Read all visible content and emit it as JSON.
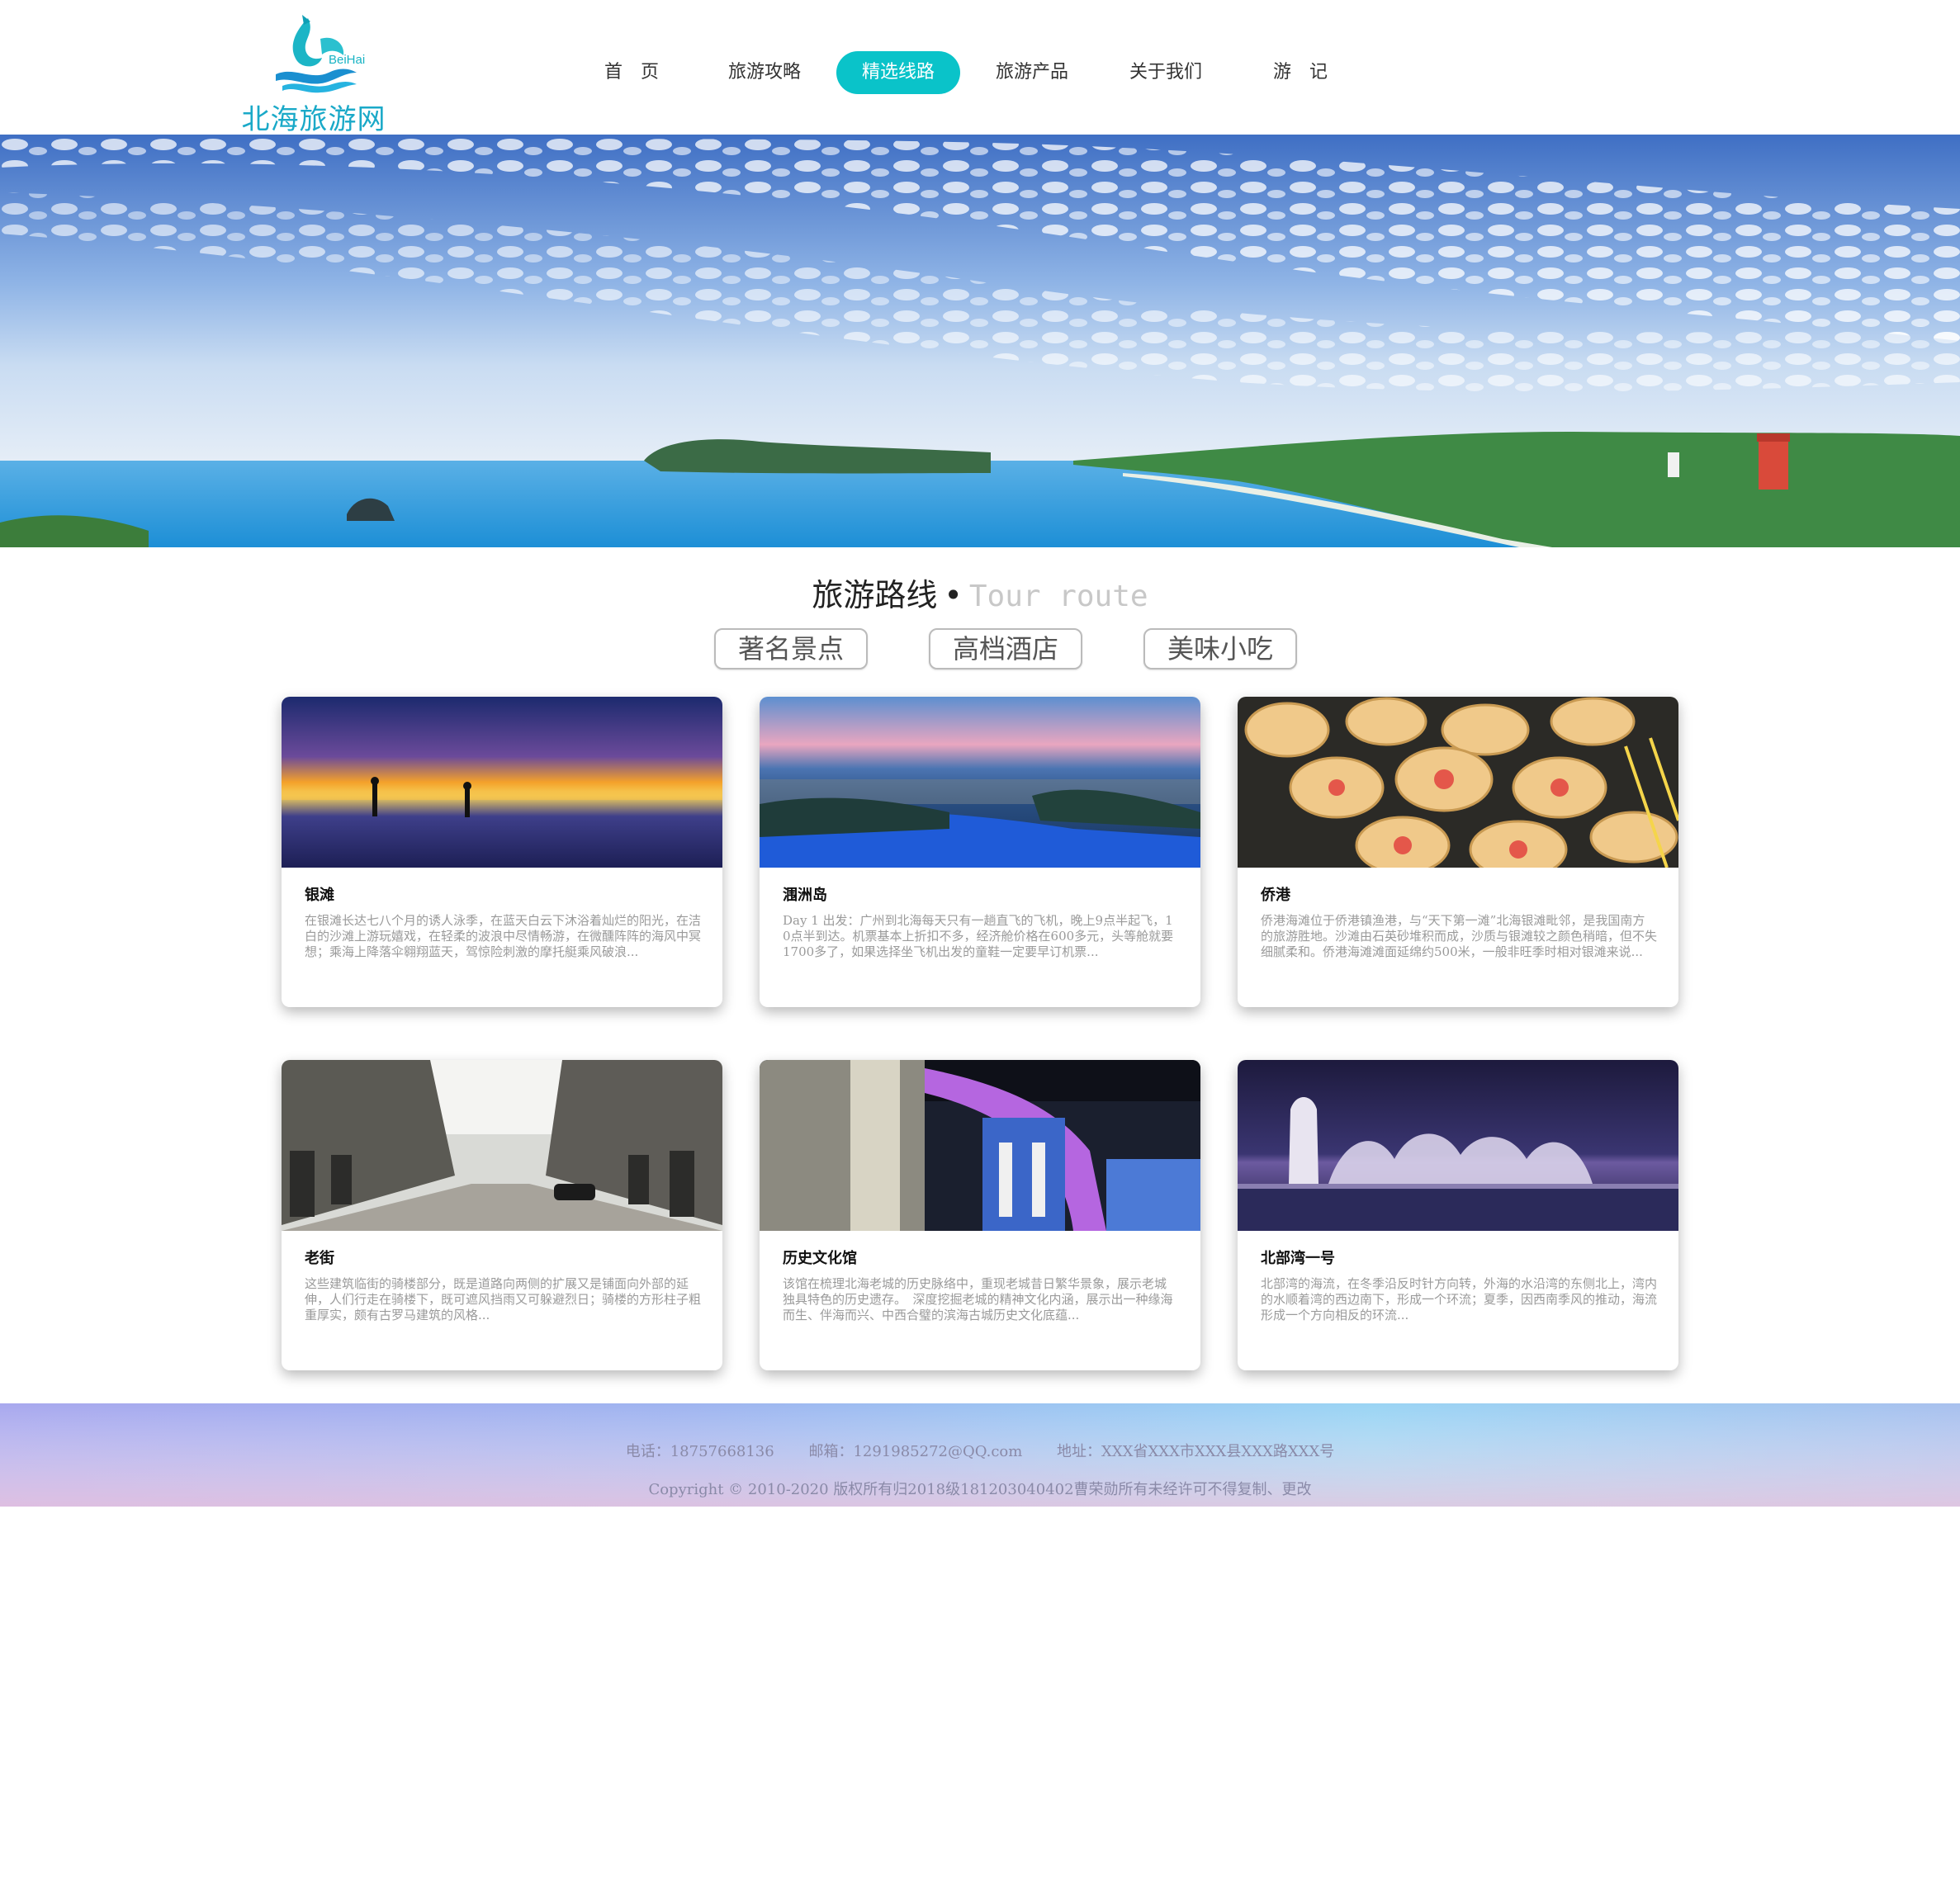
{
  "logo": {
    "title": "北海旅游网",
    "sub": "BeiHai"
  },
  "nav": {
    "items": [
      "首　页",
      "旅游攻略",
      "精选线路",
      "旅游产品",
      "关于我们",
      "游　记"
    ],
    "active_index": 2
  },
  "section": {
    "title": "旅游路线",
    "dot": "•",
    "title_en": "Tour route"
  },
  "tabs": [
    "著名景点",
    "高档酒店",
    "美味小吃"
  ],
  "cards": [
    {
      "title": "银滩",
      "desc": "在银滩长达七八个月的诱人泳季，在蓝天白云下沐浴着灿烂的阳光，在洁白的沙滩上游玩嬉戏，在轻柔的波浪中尽情畅游，在微醺阵阵的海风中冥想；乘海上降落伞翱翔蓝天，驾惊险刺激的摩托艇乘风破浪..."
    },
    {
      "title": "涠洲岛",
      "desc": "Day 1 出发：广州到北海每天只有一趟直飞的飞机，晚上9点半起飞，10点半到达。机票基本上折扣不多，经济舱价格在600多元，头等舱就要1700多了，如果选择坐飞机出发的童鞋一定要早订机票..."
    },
    {
      "title": "侨港",
      "desc": "侨港海滩位于侨港镇渔港，与“天下第一滩”北海银滩毗邻，是我国南方的旅游胜地。沙滩由石英砂堆积而成，沙质与银滩较之颜色稍暗，但不失细腻柔和。侨港海滩滩面延绵约500米，一般非旺季时相对银滩来说..."
    },
    {
      "title": "老街",
      "desc": "这些建筑临街的骑楼部分，既是道路向两侧的扩展又是铺面向外部的延伸，人们行走在骑楼下，既可遮风挡雨又可躲避烈日；骑楼的方形柱子粗重厚实，颇有古罗马建筑的风格..."
    },
    {
      "title": "历史文化馆",
      "desc": "该馆在梳理北海老城的历史脉络中，重现老城昔日繁华景象，展示老城　独具特色的历史遗存。　深度挖掘老城的精神文化内涵，展示出一种缘海而生、伴海而兴、中西合璧的滨海古城历史文化底蕴..."
    },
    {
      "title": "北部湾一号",
      "desc": "北部湾的海流，在冬季沿反时针方向转，外海的水沿湾的东侧北上，湾内的水顺着湾的西边南下，形成一个环流；夏季，因西南季风的推动，海流形成一个方向相反的环流..."
    }
  ],
  "footer": {
    "phone": "电话：18757668136",
    "email": "邮箱：1291985272@QQ.com",
    "address": "地址：XXX省XXX市XXX县XXX路XXX号",
    "copyright": "Copyright © 2010-2020 版权所有归2018级181203040402曹荣勋所有未经许可不得复制、更改"
  },
  "colors": {
    "accent": "#0ac3c9",
    "logo": "#1aa9c8"
  }
}
